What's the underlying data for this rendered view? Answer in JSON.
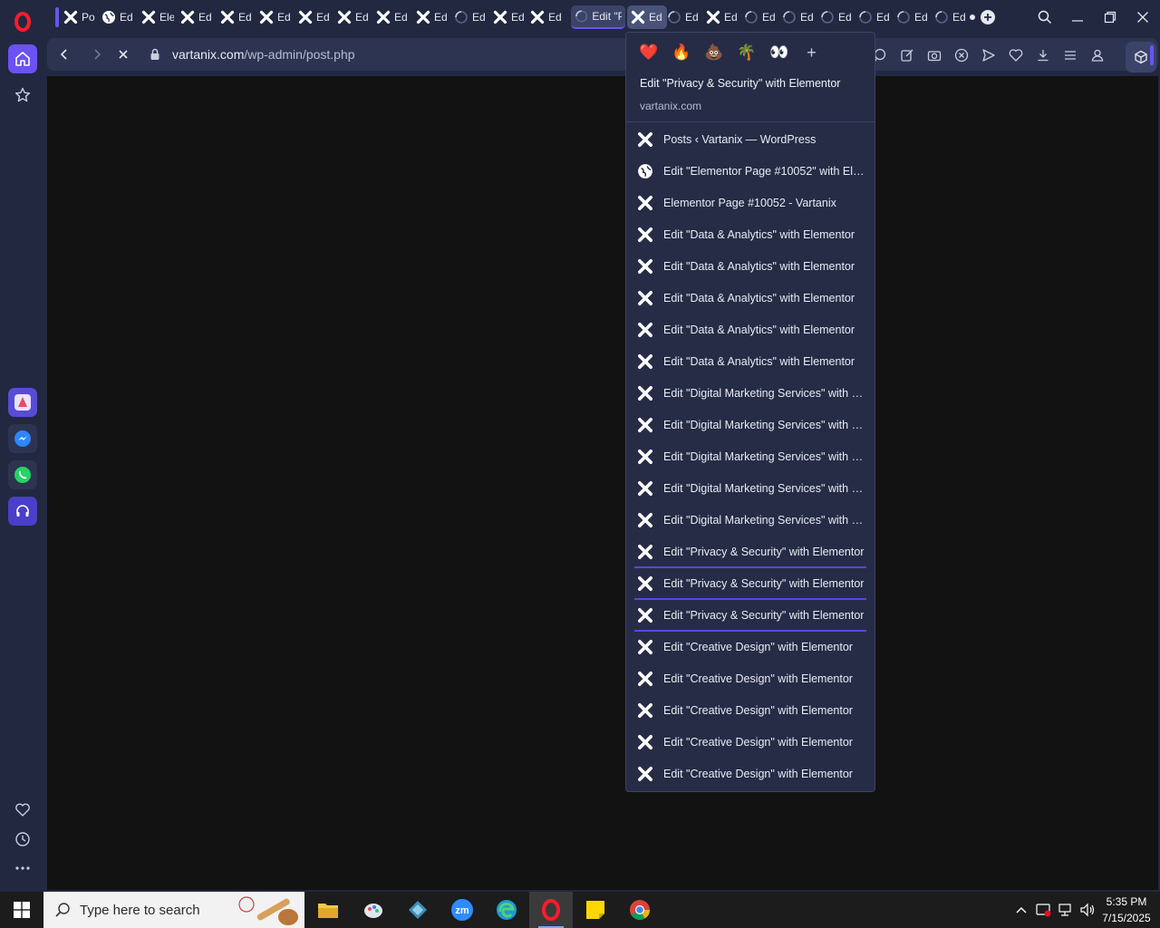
{
  "browser": {
    "accent": "#6a52f5",
    "tabs": [
      {
        "label": "Po",
        "icon": "elementor-x-icon"
      },
      {
        "label": "Ed",
        "icon": "globe-icon"
      },
      {
        "label": "Ele",
        "icon": "elementor-x-icon"
      },
      {
        "label": "Ed",
        "icon": "elementor-x-icon"
      },
      {
        "label": "Ed",
        "icon": "elementor-x-icon"
      },
      {
        "label": "Ed",
        "icon": "elementor-x-icon"
      },
      {
        "label": "Ed",
        "icon": "elementor-x-icon"
      },
      {
        "label": "Ed",
        "icon": "elementor-x-icon"
      },
      {
        "label": "Ed",
        "icon": "elementor-x-icon"
      },
      {
        "label": "Ed",
        "icon": "elementor-x-icon"
      },
      {
        "label": "Ed",
        "icon": "loading-icon"
      },
      {
        "label": "Ed",
        "icon": "elementor-x-icon"
      },
      {
        "label": "Ed",
        "icon": "elementor-x-icon"
      },
      {
        "label": "Edit \"P",
        "icon": "loading-icon"
      },
      {
        "label": "Ed",
        "icon": "elementor-x-icon"
      },
      {
        "label": "Ed",
        "icon": "loading-icon"
      },
      {
        "label": "Ed",
        "icon": "elementor-x-icon"
      },
      {
        "label": "Ed",
        "icon": "loading-icon"
      },
      {
        "label": "Ed",
        "icon": "loading-icon"
      },
      {
        "label": "Ed",
        "icon": "loading-icon"
      },
      {
        "label": "Ed",
        "icon": "loading-icon"
      },
      {
        "label": "Ed",
        "icon": "loading-icon"
      },
      {
        "label": "Ed",
        "icon": "loading-icon"
      }
    ],
    "address": {
      "host": "vartanix.com",
      "path": "/wp-admin/post.php"
    }
  },
  "tab_preview": {
    "emojis": [
      "❤️",
      "🔥",
      "💩",
      "🌴",
      "👀",
      "+"
    ],
    "title": "Edit \"Privacy & Security\" with Elementor",
    "host": "vartanix.com",
    "items": [
      {
        "label": "Posts ‹ Vartanix — WordPress",
        "icon": "elementor-x-icon",
        "selected": false
      },
      {
        "label": "Edit \"Elementor Page #10052\" with Ele...",
        "icon": "globe-icon",
        "selected": false
      },
      {
        "label": "Elementor Page #10052 - Vartanix",
        "icon": "elementor-x-icon",
        "selected": false
      },
      {
        "label": "Edit \"Data & Analytics\" with Elementor",
        "icon": "elementor-x-icon",
        "selected": false
      },
      {
        "label": "Edit \"Data & Analytics\" with Elementor",
        "icon": "elementor-x-icon",
        "selected": false
      },
      {
        "label": "Edit \"Data & Analytics\" with Elementor",
        "icon": "elementor-x-icon",
        "selected": false
      },
      {
        "label": "Edit \"Data & Analytics\" with Elementor",
        "icon": "elementor-x-icon",
        "selected": false
      },
      {
        "label": "Edit \"Data & Analytics\" with Elementor",
        "icon": "elementor-x-icon",
        "selected": false
      },
      {
        "label": "Edit \"Digital Marketing Services\" with El...",
        "icon": "elementor-x-icon",
        "selected": false
      },
      {
        "label": "Edit \"Digital Marketing Services\" with El...",
        "icon": "elementor-x-icon",
        "selected": false
      },
      {
        "label": "Edit \"Digital Marketing Services\" with El...",
        "icon": "elementor-x-icon",
        "selected": false
      },
      {
        "label": "Edit \"Digital Marketing Services\" with El...",
        "icon": "elementor-x-icon",
        "selected": false
      },
      {
        "label": "Edit \"Digital Marketing Services\" with El...",
        "icon": "elementor-x-icon",
        "selected": false
      },
      {
        "label": "Edit \"Privacy & Security\" with Elementor",
        "icon": "elementor-x-icon",
        "selected": true
      },
      {
        "label": "Edit \"Privacy & Security\" with Elementor",
        "icon": "elementor-x-icon",
        "selected": true
      },
      {
        "label": "Edit \"Privacy & Security\" with Elementor",
        "icon": "elementor-x-icon",
        "selected": true
      },
      {
        "label": "Edit \"Creative Design\" with Elementor",
        "icon": "elementor-x-icon",
        "selected": false
      },
      {
        "label": "Edit \"Creative Design\" with Elementor",
        "icon": "elementor-x-icon",
        "selected": false
      },
      {
        "label": "Edit \"Creative Design\" with Elementor",
        "icon": "elementor-x-icon",
        "selected": false
      },
      {
        "label": "Edit \"Creative Design\" with Elementor",
        "icon": "elementor-x-icon",
        "selected": false
      },
      {
        "label": "Edit \"Creative Design\" with Elementor",
        "icon": "elementor-x-icon",
        "selected": false
      }
    ]
  },
  "taskbar": {
    "search_placeholder": "Type here to search",
    "apps": [
      "file-explorer-icon",
      "paint-icon",
      "app-icon",
      "zoom-icon",
      "edge-icon",
      "opera-icon",
      "sticky-notes-icon",
      "chrome-icon"
    ],
    "time": "5:35 PM",
    "date": "7/15/2025"
  }
}
